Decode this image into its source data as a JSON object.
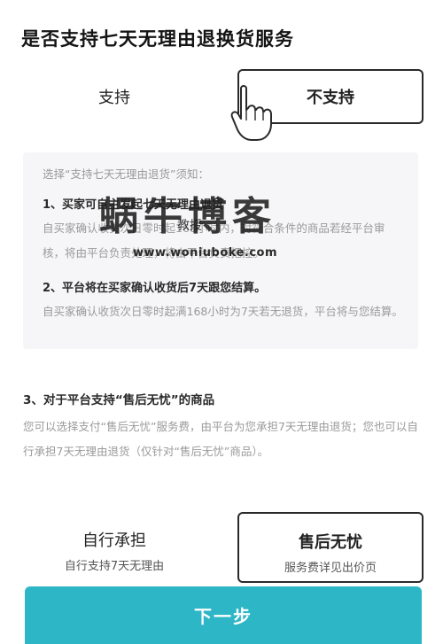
{
  "header": {
    "title": "是否支持七天无理由退换货服务"
  },
  "support_options": [
    {
      "label": "支持",
      "selected": false
    },
    {
      "label": "不支持",
      "selected": true
    }
  ],
  "rules": {
    "intro": "选择“支持七天无理由退货”须知：",
    "items": [
      {
        "heading": "1、买家可自主发起七天无理由退货",
        "body": "自买家确认收货次日零时起168小时内，对符合条件的商品若经平台审核，将由平台负责处理，将由平台负责把控。"
      },
      {
        "heading": "2、平台将在买家确认收货后7天跟您结算。",
        "body": "自买家确认收货次日零时起满168小时为7天若无退货，平台将与您结算。"
      }
    ]
  },
  "section3": {
    "title": "3、对于平台支持“售后无忧”的商品",
    "body": "您可以选择支付“售后无忧”服务费，由平台为您承担7天无理由退货；您也可以自行承担7天无理由退货（仅针对“售后无忧”商品）。"
  },
  "choices": [
    {
      "title": "自行承担",
      "subtitle": "自行支持7天无理由",
      "selected": false
    },
    {
      "title": "售后无忧",
      "subtitle": "服务费详见出价页",
      "selected": true
    }
  ],
  "footer": {
    "next_label": "下一步"
  },
  "watermark": {
    "brand": "蜗牛博客",
    "tagline": "教授",
    "url": "www.woniuboke.com"
  },
  "colors": {
    "accent": "#2cb6c6",
    "selected_border": "#2a2a2a",
    "muted_text": "#9a9a9a",
    "rule_bg": "#f6f6f8"
  },
  "icons": {
    "pointer": "hand-pointer-icon"
  }
}
